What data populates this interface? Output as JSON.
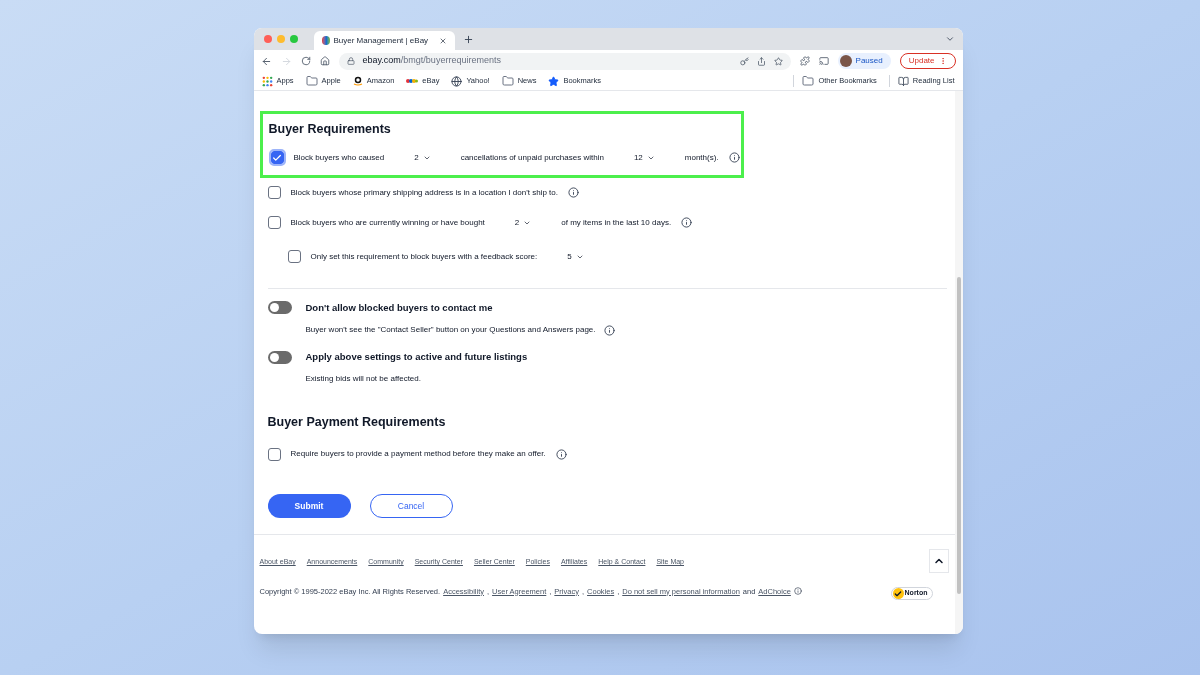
{
  "browser": {
    "tab_title": "Buyer Management | eBay",
    "url_domain": "ebay.com",
    "url_path": "/bmgt/buyerrequirements",
    "profile": "Paused",
    "update": "Update",
    "bookmarks": [
      {
        "kind": "apps",
        "label": "Apps"
      },
      {
        "kind": "folder",
        "label": "Apple"
      },
      {
        "kind": "amazon",
        "label": "Amazon"
      },
      {
        "kind": "ebay",
        "label": "eBay"
      },
      {
        "kind": "globe",
        "label": "Yahoo!"
      },
      {
        "kind": "folder",
        "label": "News"
      },
      {
        "kind": "star",
        "label": "Bookmarks"
      }
    ],
    "bookmarks_right": [
      {
        "kind": "folder",
        "label": "Other Bookmarks"
      },
      {
        "kind": "reading",
        "label": "Reading List"
      }
    ]
  },
  "requirements": {
    "title": "Buyer Requirements",
    "rules": [
      {
        "checked": true,
        "highlighted": true,
        "indented": false,
        "info": true,
        "segments": [
          {
            "kind": "text",
            "text": "Block buyers who caused"
          },
          {
            "kind": "select",
            "text": "2"
          },
          {
            "kind": "text",
            "text": "cancellations of unpaid purchases within"
          },
          {
            "kind": "select",
            "text": "12"
          },
          {
            "kind": "text",
            "text": "month(s)."
          }
        ]
      },
      {
        "checked": false,
        "highlighted": false,
        "indented": false,
        "info": true,
        "segments": [
          {
            "kind": "text",
            "text": "Block buyers whose primary shipping address is in a location I don't ship to."
          }
        ]
      },
      {
        "checked": false,
        "highlighted": false,
        "indented": false,
        "info": true,
        "segments": [
          {
            "kind": "text",
            "text": "Block buyers who are currently winning or have bought"
          },
          {
            "kind": "select",
            "text": "2"
          },
          {
            "kind": "text",
            "text": "of my items in the last 10 days."
          }
        ]
      },
      {
        "checked": false,
        "highlighted": false,
        "indented": true,
        "info": false,
        "segments": [
          {
            "kind": "text",
            "text": "Only set this requirement to block buyers with a feedback score:"
          },
          {
            "kind": "select",
            "text": "5"
          }
        ]
      }
    ]
  },
  "toggles": [
    {
      "on": false,
      "title": "Don't allow blocked buyers to contact me",
      "description": "Buyer won't see the \"Contact Seller\" button on your Questions and Answers page.",
      "info": true
    },
    {
      "on": false,
      "title": "Apply above settings to active and future listings",
      "description": "Existing bids will not be affected.",
      "info": false
    }
  ],
  "payment": {
    "title": "Buyer Payment Requirements",
    "rules": [
      {
        "checked": false,
        "text": "Require buyers to provide a payment method before they make an offer.",
        "info": true
      }
    ]
  },
  "buttons": {
    "submit": "Submit",
    "cancel": "Cancel"
  },
  "footer": {
    "links": [
      "About eBay",
      "Announcements",
      "Community",
      "Security Center",
      "Seller Center",
      "Policies",
      "Affiliates",
      "Help & Contact",
      "Site Map"
    ],
    "legal": [
      {
        "kind": "text",
        "text": "Copyright © 1995-2022 eBay Inc. All Rights Reserved."
      },
      {
        "kind": "link",
        "text": "Accessibility"
      },
      {
        "kind": "text",
        "text": ","
      },
      {
        "kind": "link",
        "text": "User Agreement"
      },
      {
        "kind": "text",
        "text": ","
      },
      {
        "kind": "link",
        "text": "Privacy"
      },
      {
        "kind": "text",
        "text": ","
      },
      {
        "kind": "link",
        "text": "Cookies"
      },
      {
        "kind": "text",
        "text": ","
      },
      {
        "kind": "link",
        "text": "Do not sell my personal information"
      },
      {
        "kind": "text",
        "text": "and"
      },
      {
        "kind": "link",
        "text": "AdChoice"
      }
    ],
    "badge": "Norton"
  }
}
